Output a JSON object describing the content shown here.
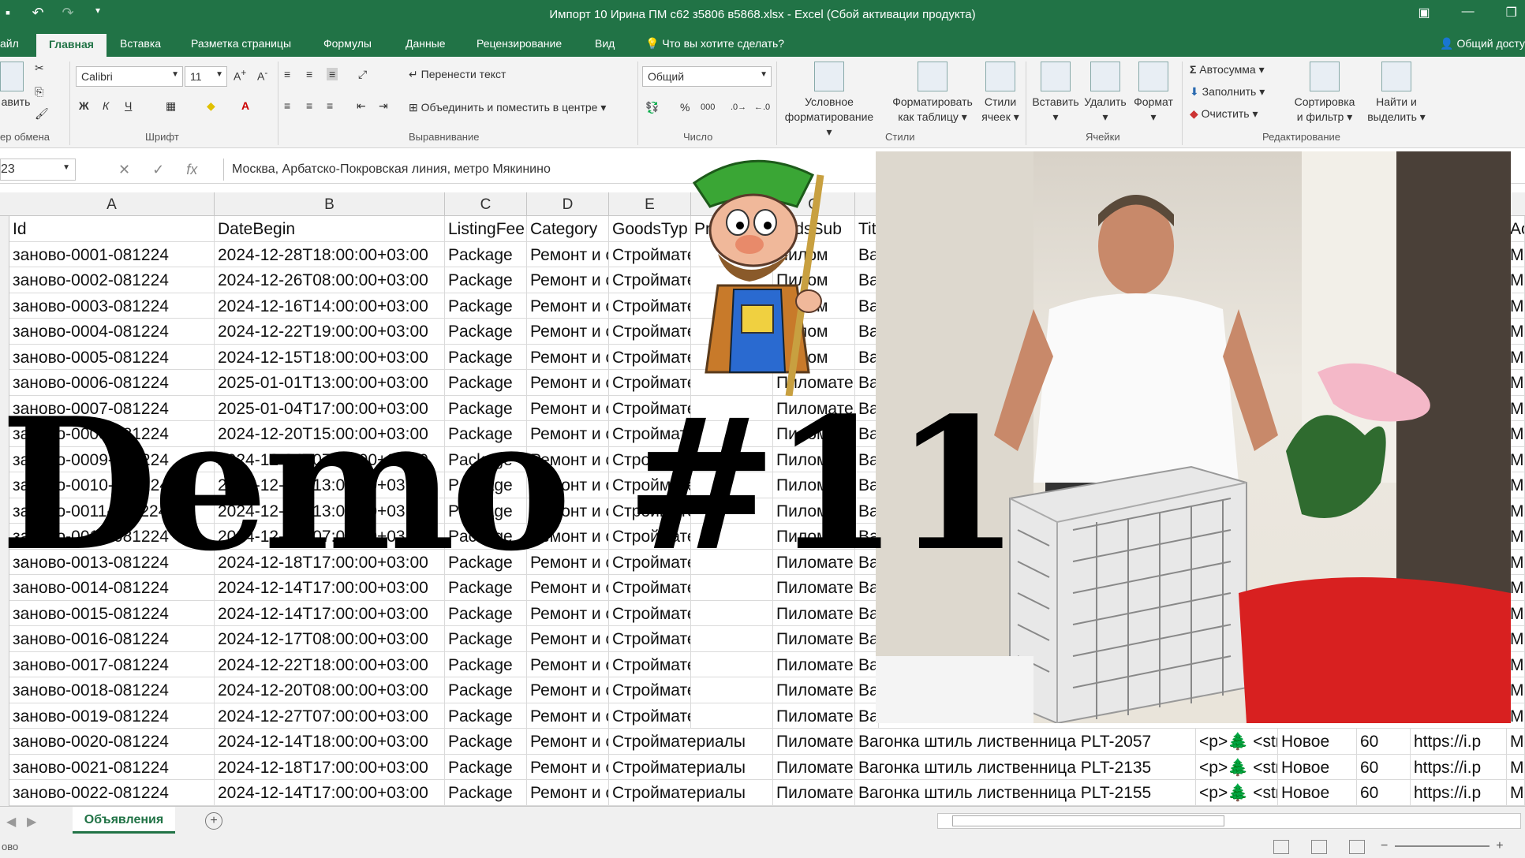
{
  "window": {
    "title": "Импорт 10 Ирина ПМ с62 з5806 в5868.xlsx - Excel (Сбой активации продукта)"
  },
  "tabs": [
    {
      "label": "айл"
    },
    {
      "label": "Главная"
    },
    {
      "label": "Вставка"
    },
    {
      "label": "Разметка страницы"
    },
    {
      "label": "Формулы"
    },
    {
      "label": "Данные"
    },
    {
      "label": "Рецензирование"
    },
    {
      "label": "Вид"
    },
    {
      "label": "Что вы хотите сделать?"
    }
  ],
  "share_label": "Общий досту",
  "ribbon": {
    "paste_label": "авить",
    "clipboard_label": "ер обмена",
    "font_name": "Calibri",
    "font_size": "11",
    "font_group_label": "Шрифт",
    "wrap_text_label": "Перенести текст",
    "merge_label": "Объединить и поместить в центре",
    "alignment_group_label": "Выравнивание",
    "number_format": "Общий",
    "number_group_label": "Число",
    "cond_format_label": [
      "Условное",
      "форматирование"
    ],
    "format_table_label": [
      "Форматировать",
      "как таблицу"
    ],
    "cell_styles_label": [
      "Стили",
      "ячеек"
    ],
    "styles_group_label": "Стили",
    "insert_label": "Вставить",
    "delete_label": "Удалить",
    "format_label": "Формат",
    "cells_group_label": "Ячейки",
    "autosum_label": "Автосумма",
    "fill_label": "Заполнить",
    "clear_label": "Очистить",
    "sort_label": [
      "Сортировка",
      "и фильтр"
    ],
    "find_label": [
      "Найти и",
      "выделить"
    ],
    "editing_group_label": "Редактирование"
  },
  "formula_bar": {
    "name_box": "23",
    "content": "Москва, Арбатско-Покровская линия, метро Мякинино"
  },
  "columns": [
    "A",
    "B",
    "C",
    "D",
    "E",
    "G"
  ],
  "header_row": [
    "Id",
    "DateBegin",
    "ListingFee",
    "Category",
    "GoodsTyp",
    "Pr",
    "oodsSub",
    "Tit",
    "Ao"
  ],
  "rows": [
    [
      "заново-0001-081224",
      "2024-12-28T18:00:00+03:00",
      "Package",
      "Ремонт и с",
      "Стройматер",
      "",
      "Пилом",
      "Ва"
    ],
    [
      "заново-0002-081224",
      "2024-12-26T08:00:00+03:00",
      "Package",
      "Ремонт и с",
      "Стройматериа",
      "",
      "Пилом",
      "Ва"
    ],
    [
      "заново-0003-081224",
      "2024-12-16T14:00:00+03:00",
      "Package",
      "Ремонт и с",
      "Стройматер",
      "",
      "Пилом",
      "Ва"
    ],
    [
      "заново-0004-081224",
      "2024-12-22T19:00:00+03:00",
      "Package",
      "Ремонт и с",
      "Стройматер",
      "",
      "Пилом",
      "Ва"
    ],
    [
      "заново-0005-081224",
      "2024-12-15T18:00:00+03:00",
      "Package",
      "Ремонт и с",
      "Стройматер",
      "",
      "Пилом",
      "Ва"
    ],
    [
      "заново-0006-081224",
      "2025-01-01T13:00:00+03:00",
      "Package",
      "Ремонт и с",
      "Стройматер",
      "",
      "Пиломате",
      "Ва"
    ],
    [
      "заново-0007-081224",
      "2025-01-04T17:00:00+03:00",
      "Package",
      "Ремонт и с",
      "Стройматериалы",
      "",
      "Пиломате",
      "Ва"
    ],
    [
      "заново-0008-081224",
      "2024-12-20T15:00:00+03:00",
      "Package",
      "Ремонт и с",
      "Стройматериа",
      "",
      "Пиломате",
      "Ва"
    ],
    [
      "заново-0009-081224",
      "2024-12-24T07:00:00+03:00",
      "Package",
      "Ремонт и с",
      "Стройматериа",
      "",
      "Пиломате",
      "Ва"
    ],
    [
      "заново-0010-081224",
      "2024-12-31T13:00:00+03:00",
      "Package",
      "Ремонт и с",
      "Стройматериа",
      "",
      "Пиломате",
      "Ва"
    ],
    [
      "заново-0011-081224",
      "2024-12-29T13:00:00+03:00",
      "Package",
      "Ремонт и с",
      "Стройматериа",
      "",
      "Пиломате",
      "Ва"
    ],
    [
      "заново-0012-081224",
      "2024-12-21T07:00:00+03:00",
      "Package",
      "Ремонт и с",
      "Стройматериа",
      "",
      "Пиломате",
      "Ва"
    ],
    [
      "заново-0013-081224",
      "2024-12-18T17:00:00+03:00",
      "Package",
      "Ремонт и с",
      "Стройматериалы",
      "",
      "Пиломате",
      "Ва"
    ],
    [
      "заново-0014-081224",
      "2024-12-14T17:00:00+03:00",
      "Package",
      "Ремонт и с",
      "Стройматериалы",
      "",
      "Пиломате",
      "Ва"
    ],
    [
      "заново-0015-081224",
      "2024-12-14T17:00:00+03:00",
      "Package",
      "Ремонт и с",
      "Стройматериалы",
      "",
      "Пиломате",
      "Ва"
    ],
    [
      "заново-0016-081224",
      "2024-12-17T08:00:00+03:00",
      "Package",
      "Ремонт и с",
      "Стройматериалы",
      "",
      "Пиломате",
      "Ва"
    ],
    [
      "заново-0017-081224",
      "2024-12-22T18:00:00+03:00",
      "Package",
      "Ремонт и с",
      "Стройматериалы",
      "",
      "Пиломате",
      "Ва"
    ],
    [
      "заново-0018-081224",
      "2024-12-20T08:00:00+03:00",
      "Package",
      "Ремонт и с",
      "Стройматериалы",
      "",
      "Пиломате",
      "Ва"
    ],
    [
      "заново-0019-081224",
      "2024-12-27T07:00:00+03:00",
      "Package",
      "Ремонт и с",
      "Стройматериалы",
      "",
      "Пиломате",
      "Ва"
    ]
  ],
  "wide_rows": [
    [
      "заново-0020-081224",
      "2024-12-14T18:00:00+03:00",
      "Package",
      "Ремонт и с",
      "Стройматериалы",
      "Пиломате",
      "Вагонка штиль лиственница PLT-2057",
      "<p>🌲 <str",
      "Новое",
      "60",
      "https://i.p",
      "Мо"
    ],
    [
      "заново-0021-081224",
      "2024-12-18T17:00:00+03:00",
      "Package",
      "Ремонт и с",
      "Стройматериалы",
      "Пиломате",
      "Вагонка штиль лиственница PLT-2135",
      "<p>🌲 <str",
      "Новое",
      "60",
      "https://i.p",
      "Мо"
    ],
    [
      "заново-0022-081224",
      "2024-12-14T17:00:00+03:00",
      "Package",
      "Ремонт и с",
      "Стройматериалы",
      "Пиломате",
      "Вагонка штиль лиственница PLT-2155",
      "<p>🌲 <str",
      "Новое",
      "60",
      "https://i.p",
      "Мо"
    ]
  ],
  "right_edge_col": "Мо",
  "overlay_text": "Demo #11",
  "sheet_tab": "Объявления",
  "status_text": "ово",
  "colors": {
    "excel_green": "#217346",
    "ribbon_bg": "#f3f3f3"
  }
}
